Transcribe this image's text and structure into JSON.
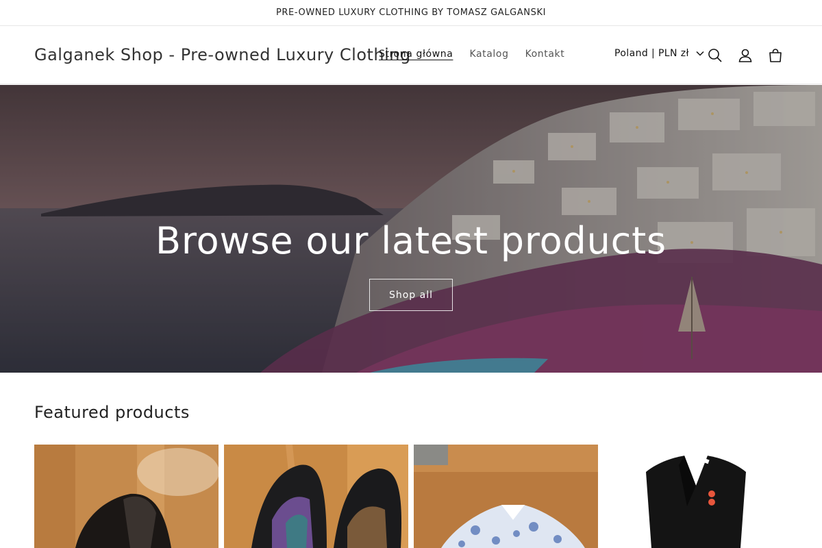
{
  "announcement": {
    "text": "PRE-OWNED LUXURY CLOTHING BY TOMASZ GALGANSKI"
  },
  "header": {
    "logo": "Galganek Shop - Pre-owned Luxury Clothing",
    "nav": [
      {
        "label": "Strona główna",
        "active": true
      },
      {
        "label": "Katalog",
        "active": false
      },
      {
        "label": "Kontakt",
        "active": false
      }
    ],
    "localization": "Poland | PLN zł",
    "icons": [
      "search-icon",
      "account-icon",
      "cart-icon"
    ]
  },
  "hero": {
    "title": "Browse our latest products",
    "button_label": "Shop all"
  },
  "featured": {
    "title": "Featured products",
    "products": [
      {
        "image": "leather-jacket-photo"
      },
      {
        "image": "sneakers-photo"
      },
      {
        "image": "patterned-shirt-photo"
      },
      {
        "image": "black-blazer-photo"
      }
    ]
  },
  "colors": {
    "text": "#121212",
    "border": "#e6e6e6",
    "hero_overlay": "#000000"
  }
}
